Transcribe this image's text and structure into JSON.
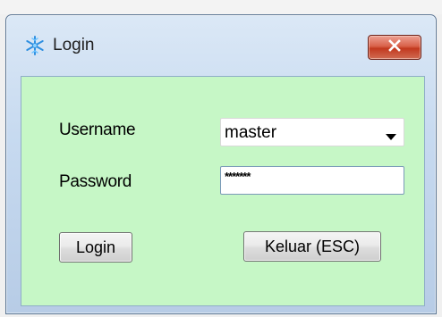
{
  "window": {
    "title": "Login",
    "icon": "snowflake-icon",
    "close_icon": "close-icon"
  },
  "form": {
    "username_label": "Username",
    "username_value": "master",
    "password_label": "Password",
    "password_value": "*******"
  },
  "buttons": {
    "login_label": "Login",
    "exit_label": "Keluar (ESC)"
  },
  "colors": {
    "client_background": "#c6f7c6",
    "close_button": "#c2391f",
    "title_bar": "#c7daf0"
  }
}
